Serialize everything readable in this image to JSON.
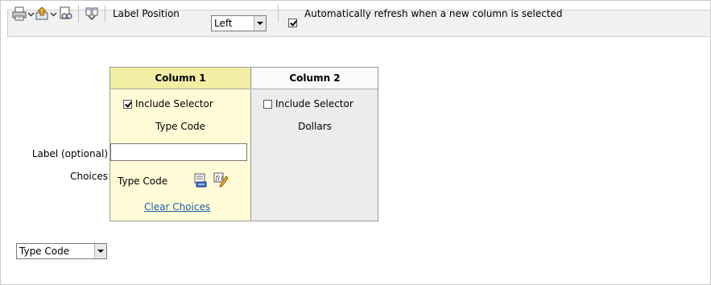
{
  "toolbar": {
    "icons": [
      "print-icon",
      "export-icon",
      "preview-icon",
      "column-properties-icon"
    ],
    "label_position_label": "Label Position",
    "label_position_value": "Left",
    "auto_refresh_checked": true,
    "auto_refresh_label": "Automatically refresh when a new column is selected"
  },
  "labels": {
    "label_optional": "Label (optional)",
    "choices": "Choices"
  },
  "columns": [
    {
      "header": "Column 1",
      "include_selector_label": "Include Selector",
      "include_selector_checked": true,
      "name": "Type Code",
      "choices_value": "Type Code",
      "clear_choices": "Clear Choices"
    },
    {
      "header": "Column 2",
      "include_selector_label": "Include Selector",
      "include_selector_checked": false,
      "name": "Dollars"
    }
  ],
  "preview": {
    "selected": "Type Code"
  },
  "colors": {
    "column1_bg": "#fffbd6",
    "column1_header": "#f3eea3",
    "column2_bg": "#ececec",
    "link": "#1a5ea8"
  }
}
